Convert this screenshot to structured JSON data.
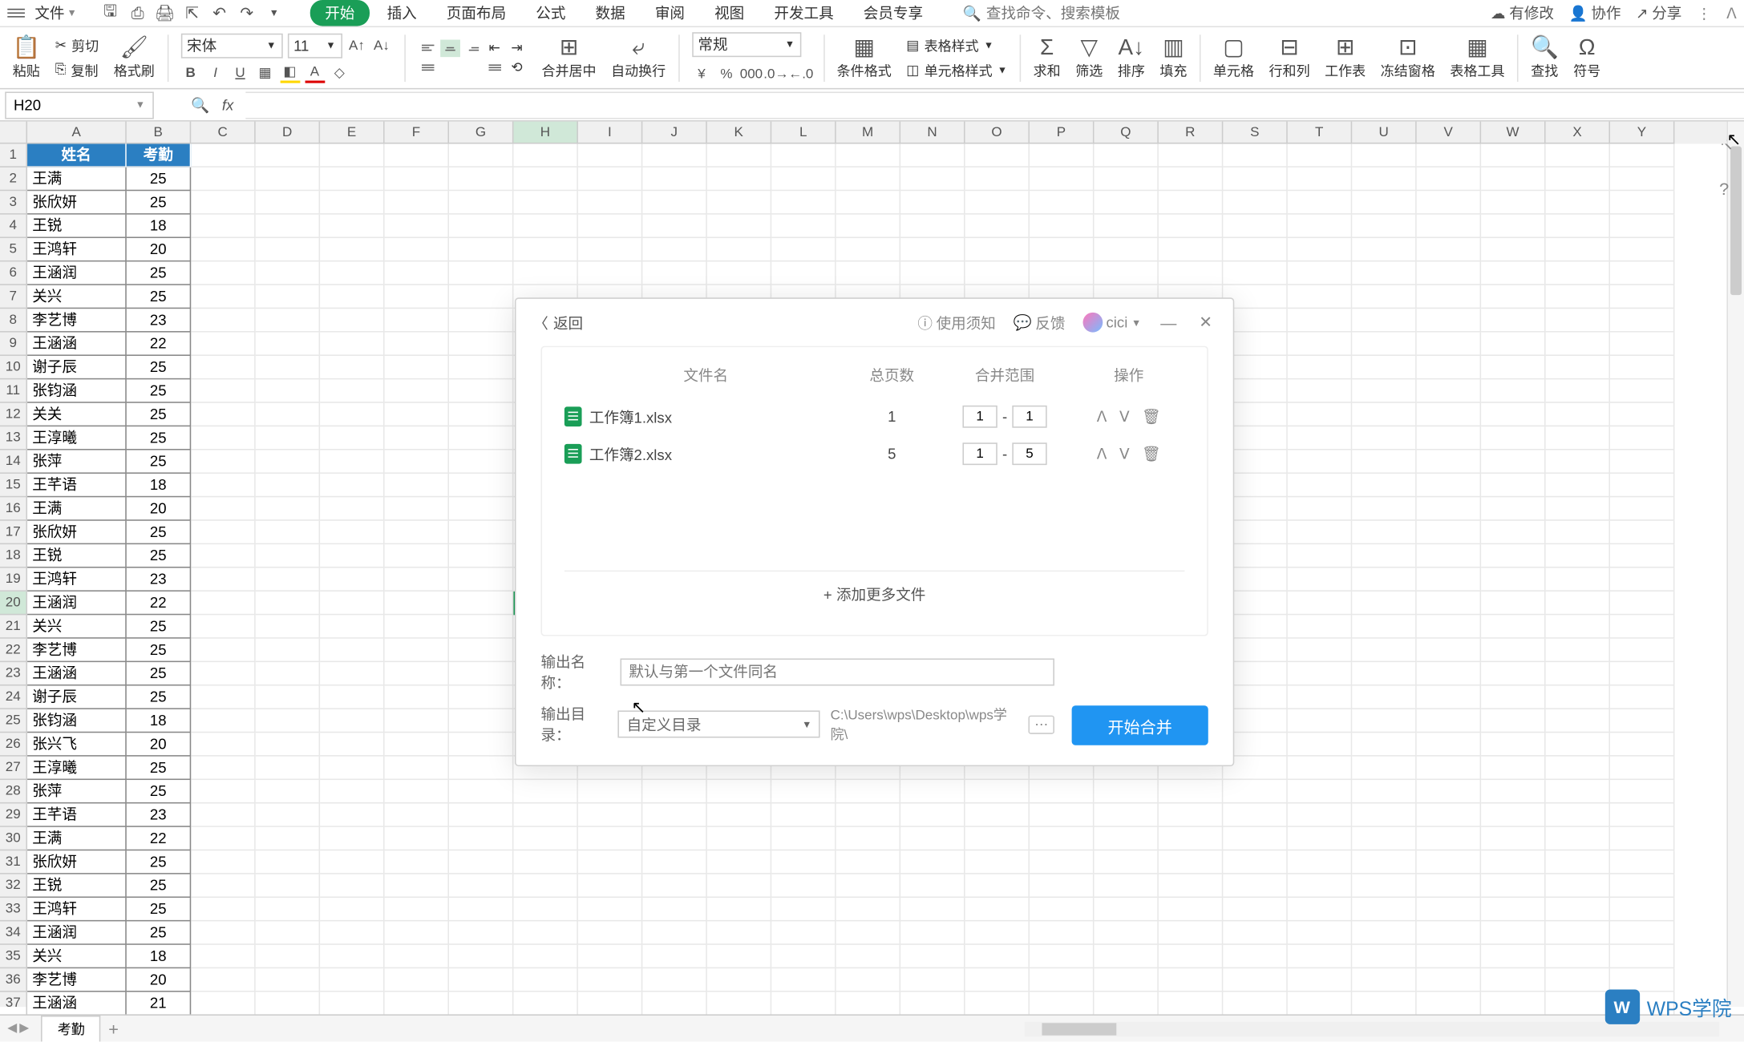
{
  "menubar": {
    "file": "文件",
    "tabs": [
      "开始",
      "插入",
      "页面布局",
      "公式",
      "数据",
      "审阅",
      "视图",
      "开发工具",
      "会员专享"
    ],
    "active_tab": 0,
    "search_placeholder": "查找命令、搜索模板",
    "right": {
      "changes": "有修改",
      "collab": "协作",
      "share": "分享"
    }
  },
  "ribbon": {
    "paste": "粘贴",
    "cut": "剪切",
    "copy": "复制",
    "format_painter": "格式刷",
    "font_name": "宋体",
    "font_size": "11",
    "number_format": "常规",
    "merge": "合并居中",
    "wrap": "自动换行",
    "cond_fmt": "条件格式",
    "table_style": "表格样式",
    "cell_style": "单元格样式",
    "sum": "求和",
    "filter": "筛选",
    "sort": "排序",
    "fill": "填充",
    "cell": "单元格",
    "rowcol": "行和列",
    "worksheet": "工作表",
    "freeze": "冻结窗格",
    "table_tool": "表格工具",
    "find": "查找",
    "symbol": "符号"
  },
  "namebox": "H20",
  "columns": [
    "A",
    "B",
    "C",
    "D",
    "E",
    "F",
    "G",
    "H",
    "I",
    "J",
    "K",
    "L",
    "M",
    "N",
    "O",
    "P",
    "Q",
    "R",
    "S",
    "T",
    "U",
    "V",
    "W",
    "X",
    "Y"
  ],
  "header_row": {
    "a": "姓名",
    "b": "考勤"
  },
  "data_rows": [
    {
      "a": "王满",
      "b": "25"
    },
    {
      "a": "张欣妍",
      "b": "25"
    },
    {
      "a": "王锐",
      "b": "18"
    },
    {
      "a": "王鸿轩",
      "b": "20"
    },
    {
      "a": "王涵润",
      "b": "25"
    },
    {
      "a": "关兴",
      "b": "25"
    },
    {
      "a": "李艺博",
      "b": "23"
    },
    {
      "a": "王涵涵",
      "b": "22"
    },
    {
      "a": "谢子辰",
      "b": "25"
    },
    {
      "a": "张钧涵",
      "b": "25"
    },
    {
      "a": "关关",
      "b": "25"
    },
    {
      "a": "王淳曦",
      "b": "25"
    },
    {
      "a": "张萍",
      "b": "25"
    },
    {
      "a": "王芊语",
      "b": "18"
    },
    {
      "a": "王满",
      "b": "20"
    },
    {
      "a": "张欣妍",
      "b": "25"
    },
    {
      "a": "王锐",
      "b": "25"
    },
    {
      "a": "王鸿轩",
      "b": "23"
    },
    {
      "a": "王涵润",
      "b": "22"
    },
    {
      "a": "关兴",
      "b": "25"
    },
    {
      "a": "李艺博",
      "b": "25"
    },
    {
      "a": "王涵涵",
      "b": "25"
    },
    {
      "a": "谢子辰",
      "b": "25"
    },
    {
      "a": "张钧涵",
      "b": "18"
    },
    {
      "a": "张兴飞",
      "b": "20"
    },
    {
      "a": "王淳曦",
      "b": "25"
    },
    {
      "a": "张萍",
      "b": "25"
    },
    {
      "a": "王芊语",
      "b": "23"
    },
    {
      "a": "王满",
      "b": "22"
    },
    {
      "a": "张欣妍",
      "b": "25"
    },
    {
      "a": "王锐",
      "b": "25"
    },
    {
      "a": "王鸿轩",
      "b": "25"
    },
    {
      "a": "王涵润",
      "b": "25"
    },
    {
      "a": "关兴",
      "b": "18"
    },
    {
      "a": "李艺博",
      "b": "20"
    },
    {
      "a": "王涵涵",
      "b": "21"
    }
  ],
  "active_cell": {
    "row": 20,
    "col": "H"
  },
  "sheet_tab": "考勤",
  "dialog": {
    "back": "返回",
    "usage": "使用须知",
    "feedback": "反馈",
    "user": "cici",
    "th_name": "文件名",
    "th_pages": "总页数",
    "th_range": "合并范围",
    "th_ops": "操作",
    "files": [
      {
        "name": "工作簿1.xlsx",
        "pages": "1",
        "from": "1",
        "to": "1"
      },
      {
        "name": "工作簿2.xlsx",
        "pages": "5",
        "from": "1",
        "to": "5"
      }
    ],
    "add_more": "添加更多文件",
    "out_name_label": "输出名称：",
    "out_name_placeholder": "默认与第一个文件同名",
    "out_dir_label": "输出目录：",
    "out_dir_value": "自定义目录",
    "out_path": "C:\\Users\\wps\\Desktop\\wps学院\\",
    "start": "开始合并"
  },
  "wps_logo": "WPS学院"
}
